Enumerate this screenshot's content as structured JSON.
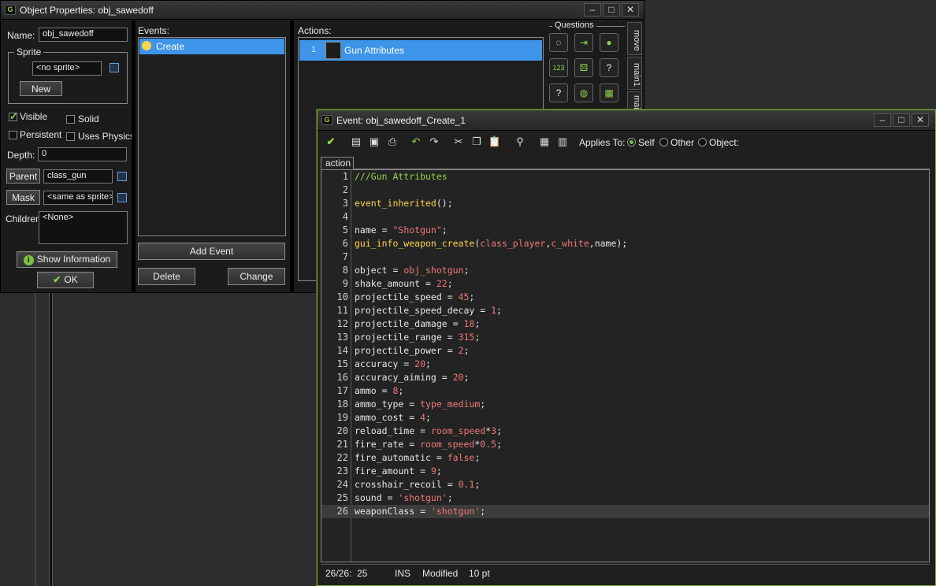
{
  "object_window": {
    "title": "Object Properties: obj_sawedoff",
    "name_label": "Name:",
    "name_value": "obj_sawedoff",
    "sprite_group": "Sprite",
    "sprite_value": "<no sprite>",
    "new_button": "New",
    "visible_label": "Visible",
    "visible_checked": true,
    "solid_label": "Solid",
    "solid_checked": false,
    "persistent_label": "Persistent",
    "persistent_checked": false,
    "uses_physics_label": "Uses Physics",
    "uses_physics_checked": false,
    "depth_label": "Depth:",
    "depth_value": "0",
    "parent_button": "Parent",
    "parent_value": "class_gun",
    "mask_button": "Mask",
    "mask_value": "<same as sprite>",
    "children_label": "Children:",
    "children_value": "<None>",
    "show_info_button": "Show Information",
    "ok_button": "OK",
    "events_label": "Events:",
    "events": [
      {
        "label": "Create",
        "icon": "lightbulb-icon",
        "selected": true
      }
    ],
    "add_event_button": "Add Event",
    "delete_button": "Delete",
    "change_button": "Change",
    "actions_label": "Actions:",
    "actions": [
      {
        "index": "1",
        "label": "Gun Attributes",
        "icon": "code-document-icon",
        "selected": true
      }
    ],
    "questions_label": "Questions",
    "side_tabs": [
      "move",
      "main1",
      "main"
    ]
  },
  "event_window": {
    "title": "Event: obj_sawedoff_Create_1",
    "applies_to_label": "Applies To:",
    "applies_options": [
      {
        "label": "Self",
        "selected": true
      },
      {
        "label": "Other",
        "selected": false
      },
      {
        "label": "Object:",
        "selected": false
      }
    ],
    "tab_label": "action",
    "current_line": 26,
    "code_lines": [
      [
        [
          "cmt",
          "///Gun Attributes"
        ]
      ],
      [],
      [
        [
          "fn",
          "event_inherited"
        ],
        [
          "id",
          "();"
        ]
      ],
      [],
      [
        [
          "id",
          "name = "
        ],
        [
          "str",
          "\"Shotgun\""
        ],
        [
          "id",
          ";"
        ]
      ],
      [
        [
          "fn",
          "gui_info_weapon_create"
        ],
        [
          "id",
          "("
        ],
        [
          "cst",
          "class_player"
        ],
        [
          "id",
          ","
        ],
        [
          "cst",
          "c_white"
        ],
        [
          "id",
          ",name);"
        ]
      ],
      [],
      [
        [
          "id",
          "object = "
        ],
        [
          "cst",
          "obj_shotgun"
        ],
        [
          "id",
          ";"
        ]
      ],
      [
        [
          "id",
          "shake_amount = "
        ],
        [
          "num",
          "22"
        ],
        [
          "id",
          ";"
        ]
      ],
      [
        [
          "id",
          "projectile_speed = "
        ],
        [
          "num",
          "45"
        ],
        [
          "id",
          ";"
        ]
      ],
      [
        [
          "id",
          "projectile_speed_decay = "
        ],
        [
          "num",
          "1"
        ],
        [
          "id",
          ";"
        ]
      ],
      [
        [
          "id",
          "projectile_damage = "
        ],
        [
          "num",
          "18"
        ],
        [
          "id",
          ";"
        ]
      ],
      [
        [
          "id",
          "projectile_range = "
        ],
        [
          "num",
          "315"
        ],
        [
          "id",
          ";"
        ]
      ],
      [
        [
          "id",
          "projectile_power = "
        ],
        [
          "num",
          "2"
        ],
        [
          "id",
          ";"
        ]
      ],
      [
        [
          "id",
          "accuracy = "
        ],
        [
          "num",
          "20"
        ],
        [
          "id",
          ";"
        ]
      ],
      [
        [
          "id",
          "accuracy_aiming = "
        ],
        [
          "num",
          "20"
        ],
        [
          "id",
          ";"
        ]
      ],
      [
        [
          "id",
          "ammo = "
        ],
        [
          "num",
          "8"
        ],
        [
          "id",
          ";"
        ]
      ],
      [
        [
          "id",
          "ammo_type = "
        ],
        [
          "cst",
          "type_medium"
        ],
        [
          "id",
          ";"
        ]
      ],
      [
        [
          "id",
          "ammo_cost = "
        ],
        [
          "num",
          "4"
        ],
        [
          "id",
          ";"
        ]
      ],
      [
        [
          "id",
          "reload_time = "
        ],
        [
          "cst",
          "room_speed"
        ],
        [
          "id",
          "*"
        ],
        [
          "num",
          "3"
        ],
        [
          "id",
          ";"
        ]
      ],
      [
        [
          "id",
          "fire_rate = "
        ],
        [
          "cst",
          "room_speed"
        ],
        [
          "id",
          "*"
        ],
        [
          "num",
          "0.5"
        ],
        [
          "id",
          ";"
        ]
      ],
      [
        [
          "id",
          "fire_automatic = "
        ],
        [
          "cst",
          "false"
        ],
        [
          "id",
          ";"
        ]
      ],
      [
        [
          "id",
          "fire_amount = "
        ],
        [
          "num",
          "9"
        ],
        [
          "id",
          ";"
        ]
      ],
      [
        [
          "id",
          "crosshair_recoil = "
        ],
        [
          "num",
          "0.1"
        ],
        [
          "id",
          ";"
        ]
      ],
      [
        [
          "id",
          "sound = "
        ],
        [
          "str",
          "'shotgun'"
        ],
        [
          "id",
          ";"
        ]
      ],
      [
        [
          "id",
          "weaponClass = "
        ],
        [
          "str",
          "'shotgun'"
        ],
        [
          "id",
          ";"
        ]
      ]
    ],
    "status": {
      "position": "26/26:",
      "column": "25",
      "mode": "INS",
      "modified": "Modified",
      "font_size": "10 pt"
    }
  }
}
